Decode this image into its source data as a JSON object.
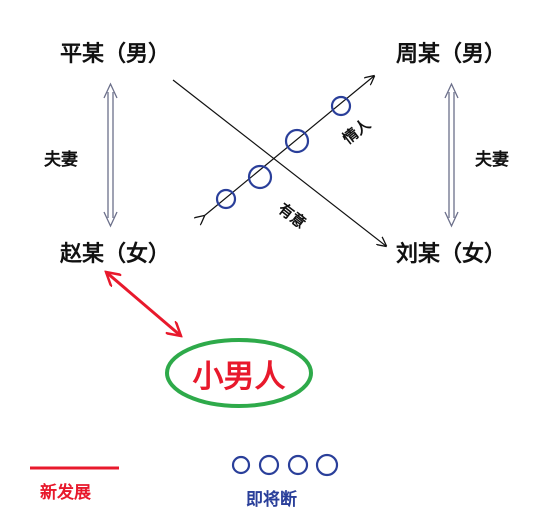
{
  "nodes": {
    "ping": "平某（男）",
    "zhou": "周某（男）",
    "zhao": "赵某（女）",
    "liu": "刘某（女）"
  },
  "relations": {
    "spouse_left": "夫妻",
    "spouse_right": "夫妻",
    "lover": "情人",
    "intention": "有意"
  },
  "new_person": "小男人",
  "legend": {
    "new_development": "新发展",
    "about_to_break": "即将断"
  },
  "colors": {
    "red": "#e8192c",
    "green": "#2eaa4a",
    "blue": "#2a3f9a",
    "black": "#111111"
  }
}
